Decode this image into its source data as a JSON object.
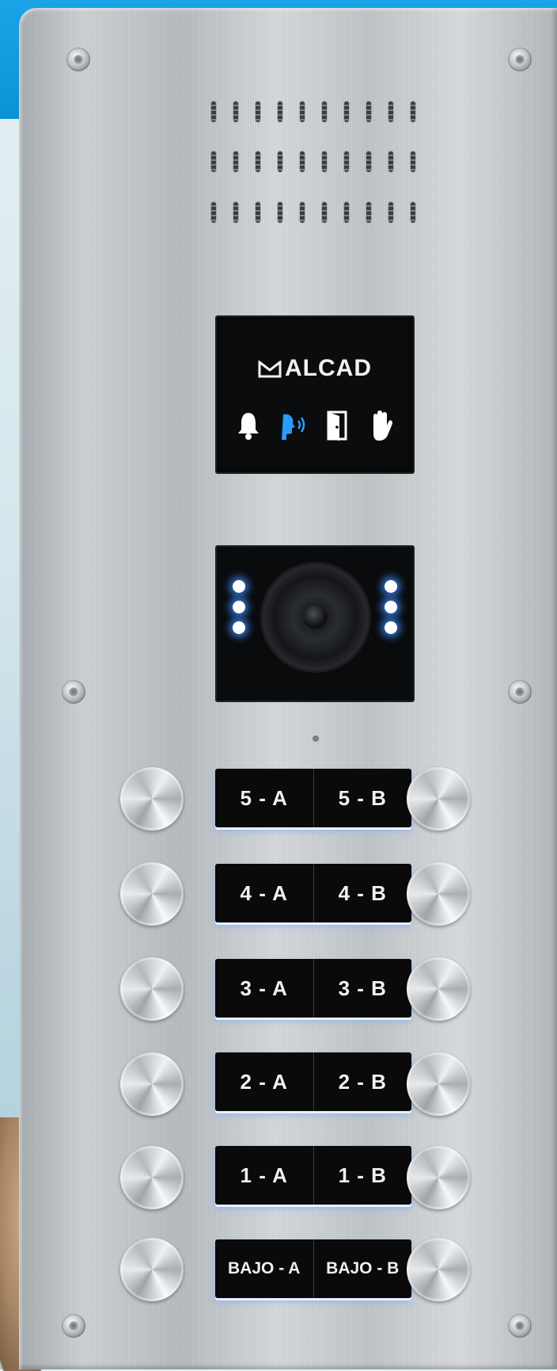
{
  "brand": {
    "name": "ALCAD"
  },
  "display_icons": [
    {
      "name": "bell-icon",
      "color": "#ffffff"
    },
    {
      "name": "talking-person-icon",
      "color": "#2a9bff"
    },
    {
      "name": "door-icon",
      "color": "#ffffff"
    },
    {
      "name": "hand-icon",
      "color": "#ffffff"
    }
  ],
  "apartments": [
    {
      "left": "5 - A",
      "right": "5 - B"
    },
    {
      "left": "4 - A",
      "right": "4 - B"
    },
    {
      "left": "3 - A",
      "right": "3 - B"
    },
    {
      "left": "2 - A",
      "right": "2 - B"
    },
    {
      "left": "1 - A",
      "right": "1 - B"
    },
    {
      "left": "BAJO - A",
      "right": "BAJO - B"
    }
  ],
  "colors": {
    "banner": "#0a93d6",
    "led": "#3c8cff",
    "panel": "#c6cbce"
  }
}
